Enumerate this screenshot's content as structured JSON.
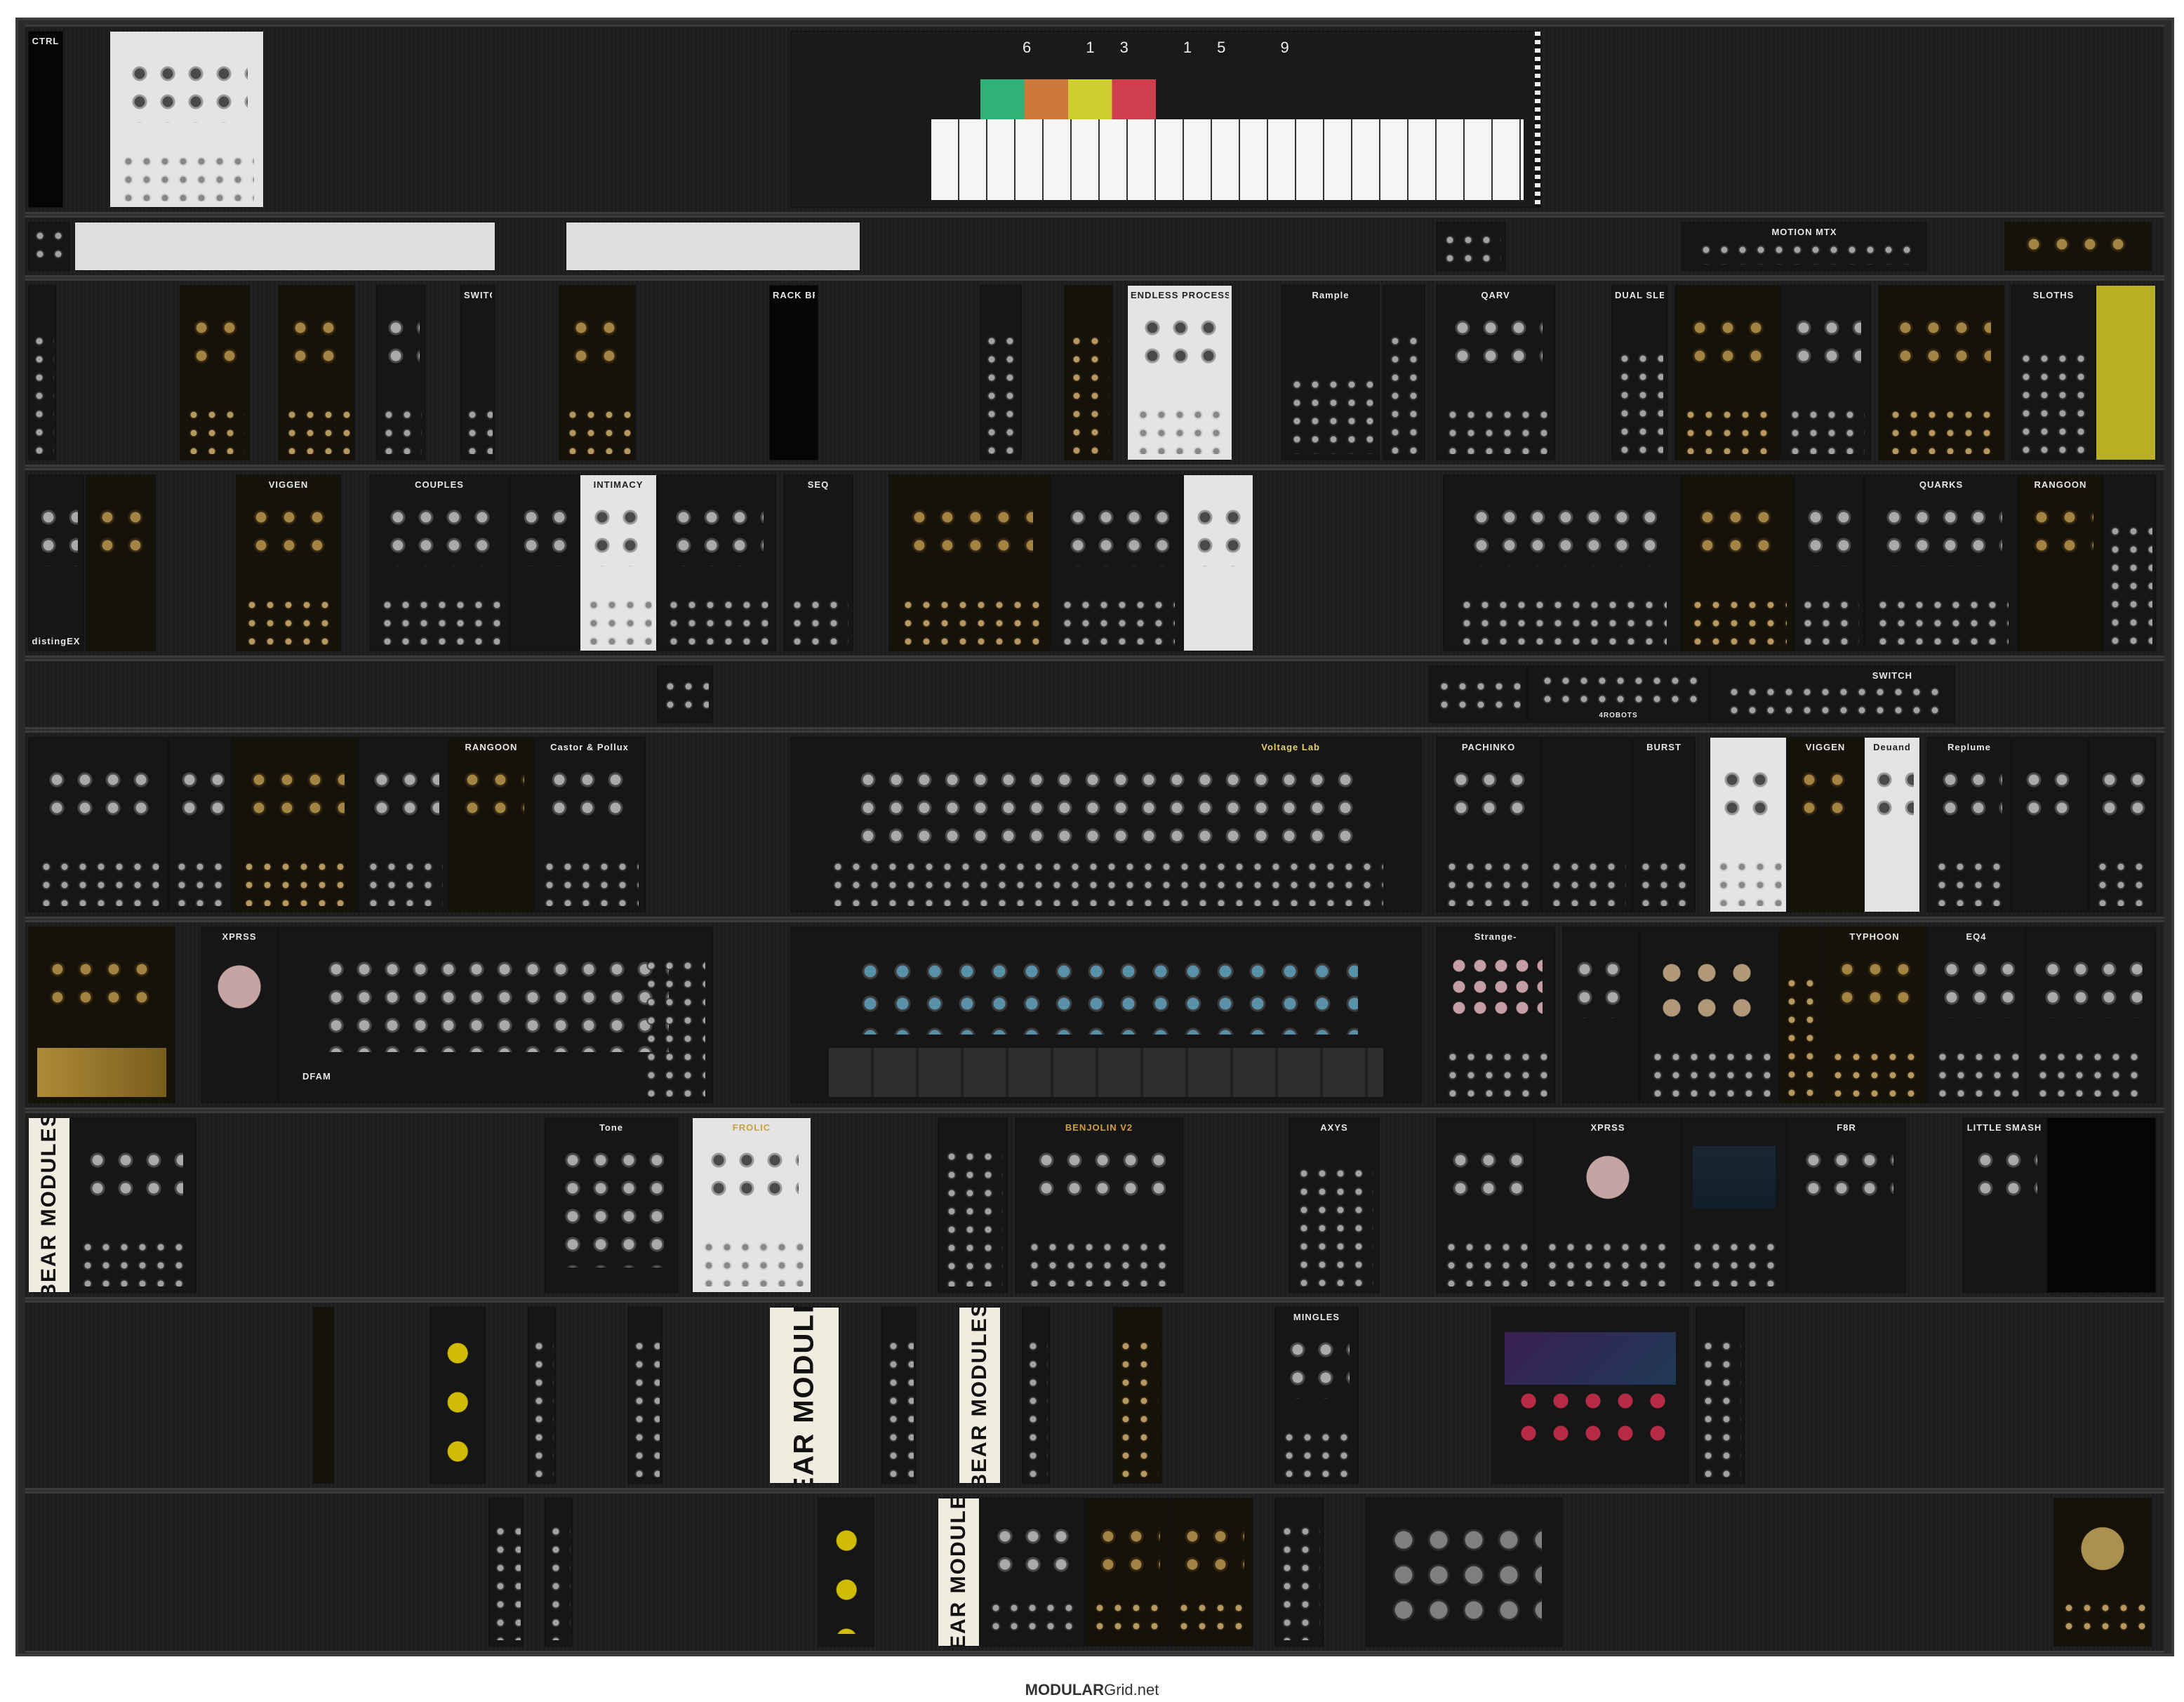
{
  "footer": {
    "brand_bold": "MODULAR",
    "brand_rest": "Grid.net"
  },
  "rows": [
    {
      "modules": [
        {
          "label": "CTRL",
          "style": "black"
        },
        {
          "label": "",
          "style": "light"
        },
        {
          "label": "",
          "style": "keys",
          "step_numbers": "6 13 15 9"
        }
      ]
    },
    {
      "modules": [
        {
          "label": "",
          "style": "dark"
        },
        {
          "label": "",
          "style": "blank"
        },
        {
          "label": "",
          "style": "blank"
        },
        {
          "label": "",
          "style": "dark"
        },
        {
          "label": "MOTION MTX",
          "style": "dark"
        },
        {
          "label": "",
          "style": "gold"
        }
      ]
    },
    {
      "modules": [
        {
          "label": "",
          "style": "dark"
        },
        {
          "label": "",
          "style": "gold"
        },
        {
          "label": "",
          "style": "gold"
        },
        {
          "label": "",
          "style": "dark"
        },
        {
          "label": "SWITCH",
          "style": "dark"
        },
        {
          "label": "",
          "style": "gold"
        },
        {
          "label": "RACK BRUTE",
          "style": "black"
        },
        {
          "label": "",
          "style": "dark"
        },
        {
          "label": "",
          "style": "gold"
        },
        {
          "label": "ENDLESS PROCESSOR",
          "style": "light"
        },
        {
          "label": "Rample",
          "style": "dark"
        },
        {
          "label": "",
          "style": "dark"
        },
        {
          "label": "QARV",
          "style": "dark"
        },
        {
          "label": "DUAL SLEW",
          "style": "dark"
        },
        {
          "label": "",
          "style": "gold"
        },
        {
          "label": "",
          "style": "dark"
        },
        {
          "label": "",
          "style": "gold"
        },
        {
          "label": "SLOTHS",
          "style": "dark"
        },
        {
          "label": "",
          "style": "gold"
        }
      ]
    },
    {
      "modules": [
        {
          "label": "distingEX",
          "style": "dark"
        },
        {
          "label": "",
          "style": "gold"
        },
        {
          "label": "VIGGEN",
          "style": "gold"
        },
        {
          "label": "COUPLES",
          "style": "dark"
        },
        {
          "label": "",
          "style": "dark"
        },
        {
          "label": "INTIMACY",
          "style": "light"
        },
        {
          "label": "",
          "style": "dark"
        },
        {
          "label": "SEQ",
          "style": "dark"
        },
        {
          "label": "",
          "style": "gold"
        },
        {
          "label": "",
          "style": "dark"
        },
        {
          "label": "",
          "style": "light"
        },
        {
          "label": "",
          "style": "dark"
        },
        {
          "label": "",
          "style": "gold"
        },
        {
          "label": "",
          "style": "dark"
        },
        {
          "label": "QUARKS",
          "style": "dark"
        },
        {
          "label": "RANGOON",
          "style": "gold"
        },
        {
          "label": "",
          "style": "dark"
        }
      ]
    },
    {
      "modules": [
        {
          "label": "",
          "style": "dark"
        },
        {
          "label": "",
          "style": "dark"
        },
        {
          "label": "4ROBOTS",
          "style": "dark"
        },
        {
          "label": "SWITCH",
          "style": "dark"
        }
      ]
    },
    {
      "modules": [
        {
          "label": "",
          "style": "dark"
        },
        {
          "label": "",
          "style": "dark"
        },
        {
          "label": "",
          "style": "gold"
        },
        {
          "label": "",
          "style": "dark"
        },
        {
          "label": "RANGOON",
          "style": "gold"
        },
        {
          "label": "Castor & Pollux",
          "style": "dark"
        },
        {
          "label": "Voltage Lab",
          "style": "dark"
        },
        {
          "label": "PACHINKO",
          "style": "dark"
        },
        {
          "label": "",
          "style": "dark"
        },
        {
          "label": "BURST",
          "style": "dark"
        },
        {
          "label": "",
          "style": "light"
        },
        {
          "label": "VIGGEN",
          "style": "gold"
        },
        {
          "label": "Deuand",
          "style": "light"
        },
        {
          "label": "Replume",
          "style": "dark"
        },
        {
          "label": "",
          "style": "dark"
        },
        {
          "label": "",
          "style": "dark"
        }
      ]
    },
    {
      "modules": [
        {
          "label": "",
          "style": "gold"
        },
        {
          "label": "XPRSS",
          "style": "dark"
        },
        {
          "label": "DFAM",
          "style": "dark"
        },
        {
          "label": "",
          "style": "dark"
        },
        {
          "label": "Strange-",
          "style": "dark"
        },
        {
          "label": "",
          "style": "dark"
        },
        {
          "label": "",
          "style": "dark"
        },
        {
          "label": "",
          "style": "dark"
        },
        {
          "label": "TYPHOON",
          "style": "gold"
        },
        {
          "label": "EQ4",
          "style": "dark"
        },
        {
          "label": "",
          "style": "dark"
        }
      ]
    },
    {
      "modules": [
        {
          "label": "BEAR MODULES",
          "style": "bear"
        },
        {
          "label": "",
          "style": "dark"
        },
        {
          "label": "Tone",
          "style": "dark"
        },
        {
          "label": "FROLIC",
          "style": "light"
        },
        {
          "label": "",
          "style": "dark"
        },
        {
          "label": "BENJOLIN V2",
          "style": "dark"
        },
        {
          "label": "AXYS",
          "style": "dark"
        },
        {
          "label": "",
          "style": "dark"
        },
        {
          "label": "XPRSS",
          "style": "dark"
        },
        {
          "label": "",
          "style": "dark"
        },
        {
          "label": "F8R",
          "style": "dark"
        },
        {
          "label": "LITTLE SMASH",
          "style": "dark"
        },
        {
          "label": "",
          "style": "black"
        }
      ]
    },
    {
      "modules": [
        {
          "label": "",
          "style": "gold"
        },
        {
          "label": "",
          "style": "yellow"
        },
        {
          "label": "",
          "style": "dark"
        },
        {
          "label": "",
          "style": "dark"
        },
        {
          "label": "BEAR MODULES",
          "style": "bear"
        },
        {
          "label": "",
          "style": "dark"
        },
        {
          "label": "BEAR MODULES",
          "style": "bear"
        },
        {
          "label": "",
          "style": "dark"
        },
        {
          "label": "",
          "style": "gold"
        },
        {
          "label": "MINGLES",
          "style": "dark"
        },
        {
          "label": "",
          "style": "dark"
        },
        {
          "label": "",
          "style": "dark"
        }
      ]
    },
    {
      "modules": [
        {
          "label": "",
          "style": "dark"
        },
        {
          "label": "",
          "style": "dark"
        },
        {
          "label": "",
          "style": "yellow"
        },
        {
          "label": "BEAR MODULES",
          "style": "bear"
        },
        {
          "label": "",
          "style": "dark"
        },
        {
          "label": "",
          "style": "gold"
        },
        {
          "label": "",
          "style": "gold"
        },
        {
          "label": "",
          "style": "dark"
        },
        {
          "label": "",
          "style": "dark"
        },
        {
          "label": "",
          "style": "gold"
        }
      ]
    }
  ]
}
